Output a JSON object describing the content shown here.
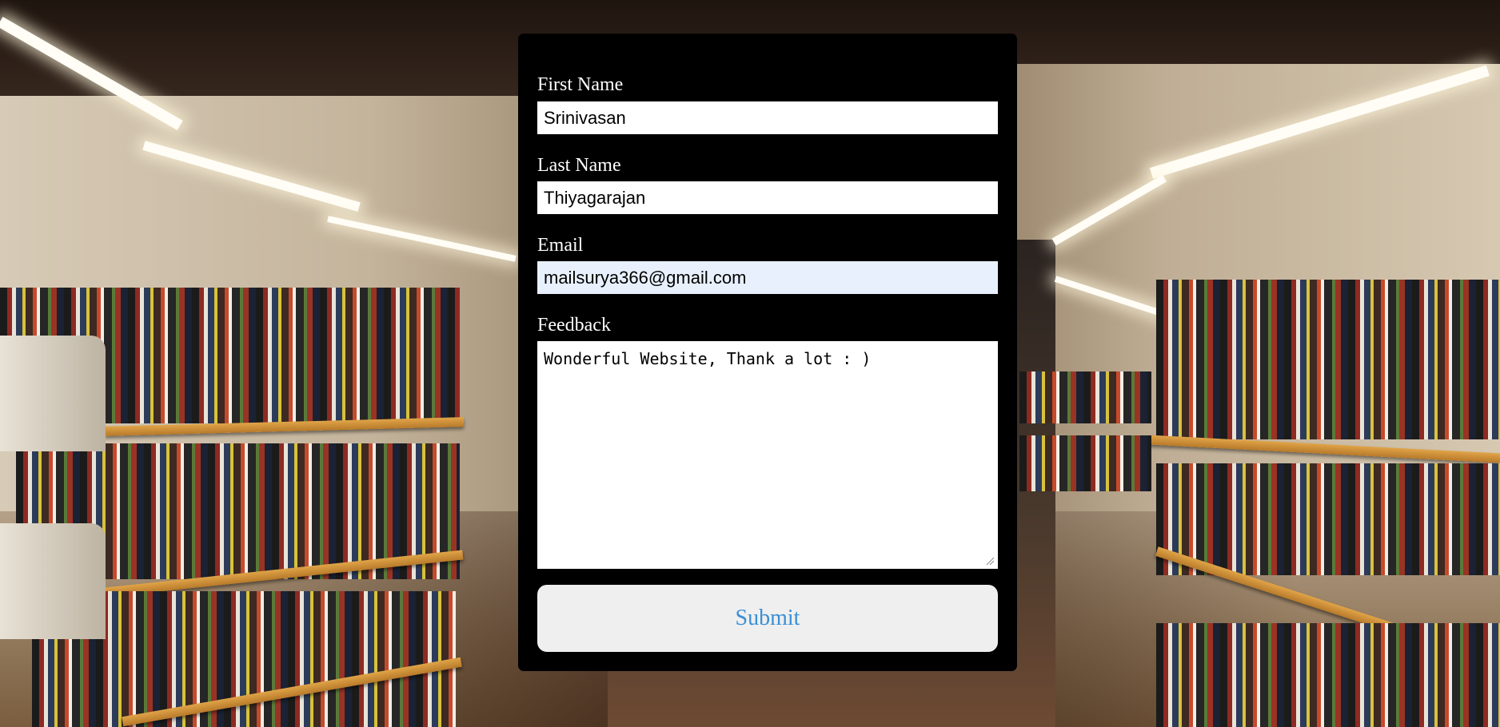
{
  "form": {
    "first_name": {
      "label": "First Name",
      "value": "Srinivasan"
    },
    "last_name": {
      "label": "Last Name",
      "value": "Thiyagarajan"
    },
    "email": {
      "label": "Email",
      "value": "mailsurya366@gmail.com"
    },
    "feedback": {
      "label": "Feedback",
      "value": "Wonderful Website, Thank a lot : )"
    },
    "submit_label": "Submit"
  },
  "colors": {
    "panel_background": "#000000",
    "label_text": "#ffffff",
    "input_background": "#ffffff",
    "autofill_background": "#e8f0fe",
    "button_background": "#efefef",
    "button_text": "#3a8fd6"
  },
  "background": {
    "icon": "library-bookshelves-photo"
  }
}
